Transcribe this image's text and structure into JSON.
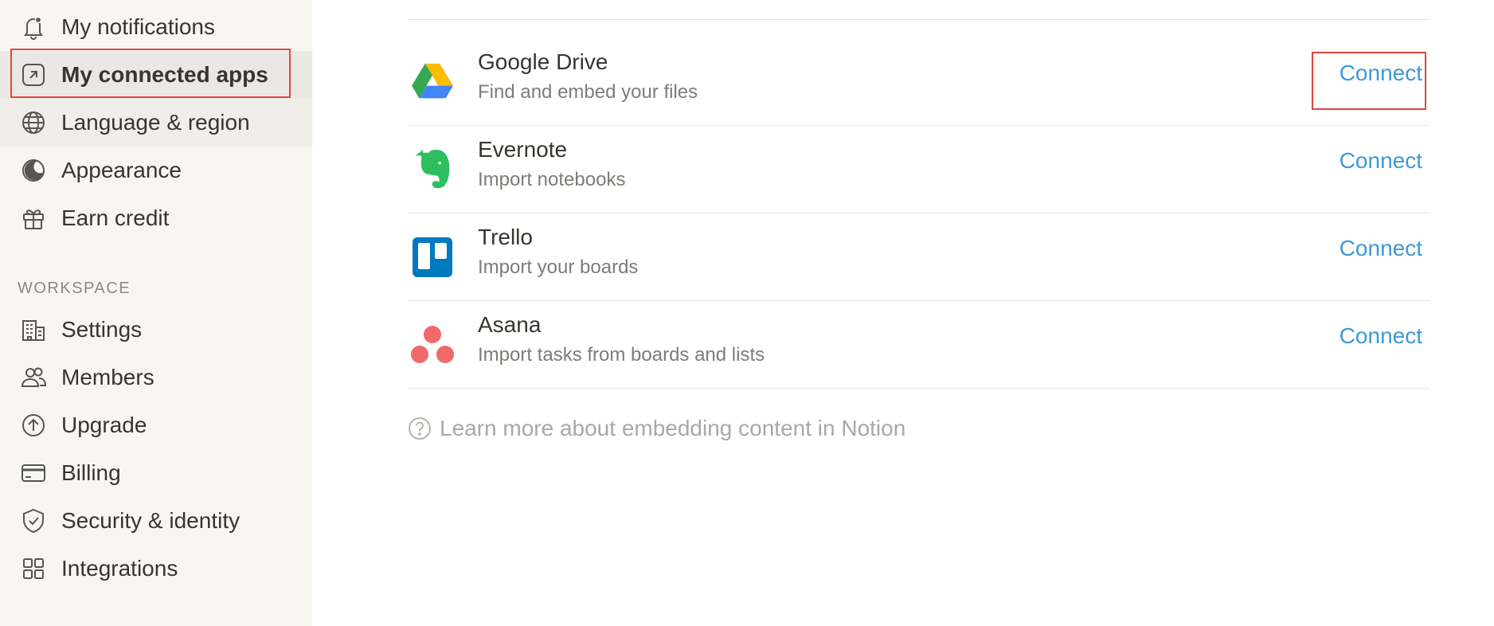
{
  "sidebar": {
    "items": [
      {
        "label": "My notifications",
        "icon": "bell-icon"
      },
      {
        "label": "My connected apps",
        "icon": "arrow-up-right-box-icon"
      },
      {
        "label": "Language & region",
        "icon": "globe-icon"
      },
      {
        "label": "Appearance",
        "icon": "moon-icon"
      },
      {
        "label": "Earn credit",
        "icon": "gift-icon"
      }
    ],
    "workspace_title": "WORKSPACE",
    "workspace_items": [
      {
        "label": "Settings",
        "icon": "building-icon"
      },
      {
        "label": "Members",
        "icon": "people-icon"
      },
      {
        "label": "Upgrade",
        "icon": "arrow-up-circle-icon"
      },
      {
        "label": "Billing",
        "icon": "credit-card-icon"
      },
      {
        "label": "Security & identity",
        "icon": "shield-check-icon"
      },
      {
        "label": "Integrations",
        "icon": "grid-icon"
      }
    ]
  },
  "apps": [
    {
      "name": "Google Drive",
      "description": "Find and embed your files",
      "action": "Connect",
      "icon": "google-drive-icon"
    },
    {
      "name": "Evernote",
      "description": "Import notebooks",
      "action": "Connect",
      "icon": "evernote-icon"
    },
    {
      "name": "Trello",
      "description": "Import your boards",
      "action": "Connect",
      "icon": "trello-icon"
    },
    {
      "name": "Asana",
      "description": "Import tasks from boards and lists",
      "action": "Connect",
      "icon": "asana-icon"
    }
  ],
  "learn_more": "Learn more about embedding content in Notion",
  "colors": {
    "accent_link": "#3c9ad4",
    "highlight_box": "#e0473b",
    "sidebar_bg": "#f7f6f3"
  }
}
